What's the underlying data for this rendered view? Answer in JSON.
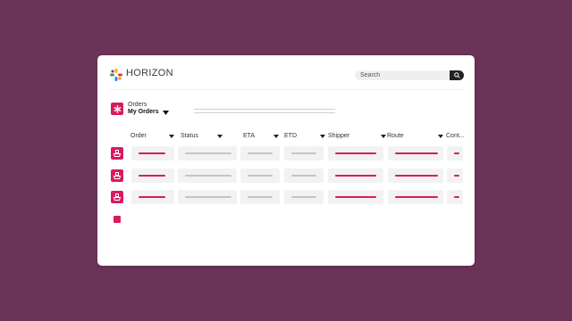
{
  "app": {
    "brand": "HORIZON",
    "logo_icon": "pinwheel-logo-icon"
  },
  "search": {
    "placeholder": "Search",
    "icon": "search-icon"
  },
  "orders": {
    "title": "Orders",
    "view": "My Orders",
    "icon": "asterisk-icon"
  },
  "table": {
    "columns": [
      "Order",
      "Status",
      "ETA",
      "ETD",
      "Shipper",
      "Route",
      "Cont..."
    ],
    "row_icon": "ship-icon",
    "row_count": 3
  },
  "colors": {
    "background": "#6b3358",
    "accent": "#d81b60",
    "placeholder": "#c4c4c4"
  }
}
